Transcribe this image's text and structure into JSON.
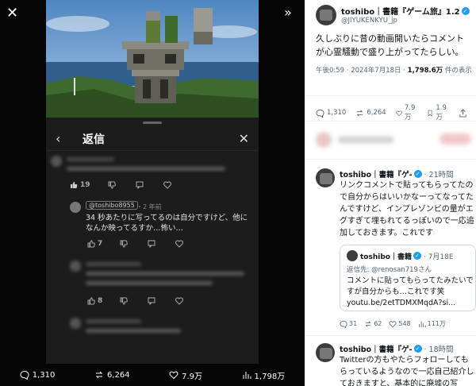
{
  "viewer": {
    "close_glyph": "✕",
    "expand_glyph": "»",
    "reply_title": "返信",
    "back_glyph": "‹",
    "reply_close_glyph": "✕",
    "focus_comment": {
      "handle": "@toshibo8955",
      "age": "・2 年前",
      "text": "34 秒あたりに写ってるのは自分ですけど、他になんか映ってるすか…怖い…"
    },
    "counts": {
      "first_likes": "19",
      "focus_likes": "7",
      "third_likes": "8"
    },
    "bottom": {
      "replies": "1,310",
      "reposts": "6,264",
      "likes": "7.9万",
      "views": "1,798万"
    }
  },
  "tweet": {
    "name": "toshibo｜書籍『ゲーム旅』1.2",
    "handle": "@JIYUKENKYU_jp",
    "text": "久しぶりに昔の動画開いたらコメントが心霊騒動で盛り上がってたらしい。",
    "time": "午後0:59 · 2024年7月18日 · ",
    "views": "1,798.6万",
    "views_suffix": " 件の表示",
    "replies": "1,310",
    "reposts": "6,264",
    "likes": "7.9万",
    "bookmarks": "1.9万"
  },
  "replies": [
    {
      "name": "toshibo｜書籍『ゲ-",
      "time": "· 21時間",
      "text": "リンクコメントで貼ってもらってたので自分からはいいかなーってなってたんですけど、インプレゾンビの量がエグすぎて埋もれてるっぽいので一応追加しておきます。これです",
      "quote": {
        "name": "toshibo｜書籍",
        "date": "· 7月18E",
        "sub": "返信先: @renosan719さん",
        "text": "コメントに貼ってもらってたみたいですが自分からも…これです笑 youtu.be/2etTDMXMqdA?si..."
      },
      "counts": {
        "replies": "31",
        "reposts": "62",
        "likes": "548",
        "views": "111万"
      }
    },
    {
      "name": "toshibo｜書籍『ゲ-",
      "time": "· 18時間",
      "text": "Twitterの方もやたらフォローしてもらっているようなので一応自己紹介しておきますと、基本的に廃墟の写"
    }
  ]
}
